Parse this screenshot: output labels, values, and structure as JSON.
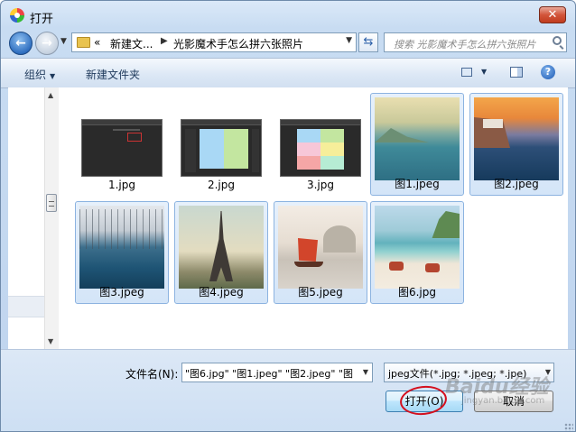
{
  "window": {
    "title": "打开",
    "close_label": "✕"
  },
  "nav": {
    "back_glyph": "←",
    "forward_glyph": "→",
    "breadcrumb": [
      "«",
      "新建文...",
      "光影魔术手怎么拼六张照片"
    ],
    "search_placeholder": "搜索 光影魔术手怎么拼六张照片"
  },
  "toolbar": {
    "organize": "组织",
    "new_folder": "新建文件夹",
    "help": "?"
  },
  "files": [
    {
      "name": "1.jpg",
      "selected": false,
      "kind": "screenshot-dark"
    },
    {
      "name": "2.jpg",
      "selected": false,
      "kind": "screenshot-two-panel"
    },
    {
      "name": "3.jpg",
      "selected": false,
      "kind": "screenshot-six-panel"
    },
    {
      "name": "图1.jpeg",
      "selected": true,
      "kind": "photo-lake"
    },
    {
      "name": "图2.jpeg",
      "selected": true,
      "kind": "photo-coast"
    },
    {
      "name": "图3.jpeg",
      "selected": true,
      "kind": "photo-winter-trees"
    },
    {
      "name": "图4.jpeg",
      "selected": true,
      "kind": "photo-eiffel"
    },
    {
      "name": "图5.jpeg",
      "selected": true,
      "kind": "photo-venice"
    },
    {
      "name": "图6.jpg",
      "selected": true,
      "kind": "photo-beach"
    }
  ],
  "bottom": {
    "filename_label": "文件名(N):",
    "filename_value": "\"图6.jpg\" \"图1.jpeg\" \"图2.jpeg\" \"图",
    "filetype_value": "jpeg文件(*.jpg; *.jpeg; *.jpe)",
    "open_button": "打开(O)",
    "cancel_button": "取消"
  },
  "watermark": {
    "text": "Baidu经验",
    "sub": "jingyan.baidu.com"
  },
  "colors": {
    "annotation_circle": "#d4101e",
    "selection": "#d4e5f8"
  }
}
